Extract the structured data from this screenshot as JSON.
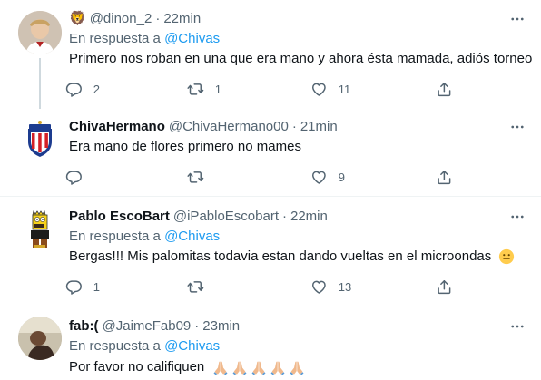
{
  "tweets": [
    {
      "name": "",
      "handle": "@dinon_2",
      "time": "22min",
      "reply_prefix": "En respuesta a",
      "reply_to": "@Chivas",
      "text": "Primero nos roban en una que era mano y ahora ésta mamada, adiós torneo",
      "replies": "2",
      "retweets": "1",
      "likes": "11"
    },
    {
      "name": "ChivaHermano",
      "handle": "@ChivaHermano00",
      "time": "21min",
      "text": "Era mano de flores primero no mames",
      "replies": "",
      "retweets": "",
      "likes": "9"
    },
    {
      "name": "Pablo EscoBart",
      "handle": "@iPabloEscobart",
      "time": "22min",
      "reply_prefix": "En respuesta a",
      "reply_to": "@Chivas",
      "text": "Bergas!!! Mis palomitas todavia estan dando vueltas en el microondas",
      "replies": "1",
      "retweets": "",
      "likes": "13"
    },
    {
      "name": "fab:(",
      "handle": "@JaimeFab09",
      "time": "23min",
      "reply_prefix": "En respuesta a",
      "reply_to": "@Chivas",
      "text": "Por favor no califiquen"
    }
  ],
  "separator": "·",
  "icons": {
    "name_badge": "lion-face-icon",
    "more": "more-dots-icon",
    "reply": "reply-bubble-icon",
    "retweet": "retweet-icon",
    "like": "heart-icon",
    "share": "share-icon",
    "emoji_smile": "slightly-smiling-face-icon",
    "emoji_pray": "folded-hands-icon"
  },
  "colors": {
    "text": "#0f1419",
    "secondary": "#536471",
    "link": "#1d9bf0",
    "divider": "#eff3f4",
    "thread_line": "#cfd9de"
  }
}
